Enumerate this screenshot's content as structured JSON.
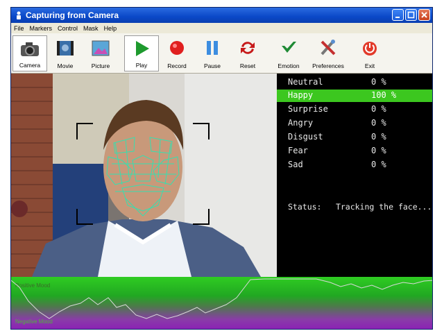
{
  "window": {
    "title": "Capturing from Camera"
  },
  "menu": [
    "File",
    "Markers",
    "Control",
    "Mask",
    "Help"
  ],
  "toolbar": {
    "camera": "Camera",
    "movie": "Movie",
    "picture": "Picture",
    "play": "Play",
    "record": "Record",
    "pause": "Pause",
    "reset": "Reset",
    "emotion": "Emotion",
    "preferences": "Preferences",
    "exit": "Exit"
  },
  "emotions": [
    {
      "name": "Neutral",
      "value": "0 %"
    },
    {
      "name": "Happy",
      "value": "100 %"
    },
    {
      "name": "Surprise",
      "value": "0 %"
    },
    {
      "name": "Angry",
      "value": "0 %"
    },
    {
      "name": "Disgust",
      "value": "0 %"
    },
    {
      "name": "Fear",
      "value": "0 %"
    },
    {
      "name": "Sad",
      "value": "0 %"
    }
  ],
  "active_emotion": "Happy",
  "status": {
    "label": "Status:",
    "value": "Tracking the face..."
  },
  "mood": {
    "positive": "Positive Mood",
    "negative": "Negative Mood"
  },
  "colors": {
    "title_bar": "#0a48c8",
    "highlight": "#3cc71f",
    "mesh": "#35e0b0",
    "positive": "#2fcc22",
    "negative": "#8b1fb6"
  }
}
